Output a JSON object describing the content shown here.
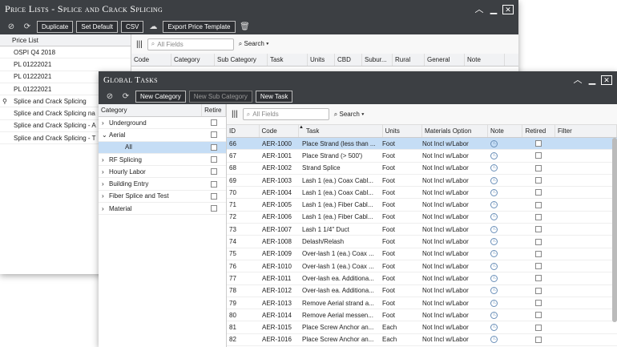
{
  "price_lists": {
    "title": "Price Lists - Splice and Crack Splicing",
    "buttons": {
      "duplicate": "Duplicate",
      "set_default": "Set Default",
      "csv": "CSV",
      "export": "Export Price Template"
    },
    "list_header": "Price List",
    "items": [
      "OSPI Q4 2018",
      "PL 01222021",
      "PL 01222021",
      "PL 01222021",
      "Splice and Crack Splicing",
      "Splice and Crack Splicing na",
      "Splice and Crack Splicing - A",
      "Splice and Crack Splicing - T"
    ],
    "search_placeholder": "All Fields",
    "search_label": "Search",
    "columns": [
      "Code",
      "Category",
      "Sub Category",
      "Task",
      "Units",
      "CBD",
      "Subur...",
      "Rural",
      "General",
      "Note"
    ]
  },
  "global_tasks": {
    "title": "Global Tasks",
    "buttons": {
      "new_category": "New Category",
      "new_sub_category": "New Sub Category",
      "new_task": "New Task"
    },
    "category_header": "Category",
    "retire_header": "Retire",
    "categories": [
      {
        "label": "Underground",
        "chev": "›",
        "indent": false,
        "sel": false
      },
      {
        "label": "Aerial",
        "chev": "⌄",
        "indent": false,
        "sel": false
      },
      {
        "label": "All",
        "chev": "",
        "indent": true,
        "sel": true
      },
      {
        "label": "RF Splicing",
        "chev": "›",
        "indent": false,
        "sel": false
      },
      {
        "label": "Hourly Labor",
        "chev": "›",
        "indent": false,
        "sel": false
      },
      {
        "label": "Building Entry",
        "chev": "›",
        "indent": false,
        "sel": false
      },
      {
        "label": "Fiber Splice and Test",
        "chev": "›",
        "indent": false,
        "sel": false
      },
      {
        "label": "Material",
        "chev": "›",
        "indent": false,
        "sel": false
      }
    ],
    "search_placeholder": "All Fields",
    "search_label": "Search",
    "columns": [
      "ID",
      "Code",
      "Task",
      "Units",
      "Materials Option",
      "Note",
      "Retired",
      "Filter"
    ],
    "rows": [
      [
        "66",
        "AER-1000",
        "Place Strand (less than ...",
        "Foot",
        "Not Incl w/Labor"
      ],
      [
        "67",
        "AER-1001",
        "Place Strand (> 500')",
        "Foot",
        "Not Incl w/Labor"
      ],
      [
        "68",
        "AER-1002",
        "Strand Splice",
        "Foot",
        "Not Incl w/Labor"
      ],
      [
        "69",
        "AER-1003",
        "Lash 1 (ea.) Coax Cabl...",
        "Foot",
        "Not Incl w/Labor"
      ],
      [
        "70",
        "AER-1004",
        "Lash 1 (ea.) Coax Cabl...",
        "Foot",
        "Not Incl w/Labor"
      ],
      [
        "71",
        "AER-1005",
        "Lash 1 (ea.) Fiber Cabl...",
        "Foot",
        "Not Incl w/Labor"
      ],
      [
        "72",
        "AER-1006",
        "Lash 1 (ea.) Fiber Cabl...",
        "Foot",
        "Not Incl w/Labor"
      ],
      [
        "73",
        "AER-1007",
        "Lash 1 1/4\" Duct",
        "Foot",
        "Not Incl w/Labor"
      ],
      [
        "74",
        "AER-1008",
        "Delash/Relash",
        "Foot",
        "Not Incl w/Labor"
      ],
      [
        "75",
        "AER-1009",
        "Over-lash 1 (ea.) Coax ...",
        "Foot",
        "Not Incl w/Labor"
      ],
      [
        "76",
        "AER-1010",
        "Over-lash 1 (ea.) Coax ...",
        "Foot",
        "Not Incl w/Labor"
      ],
      [
        "77",
        "AER-1011",
        "Over-lash ea. Additiona...",
        "Foot",
        "Not Incl w/Labor"
      ],
      [
        "78",
        "AER-1012",
        "Over-lash ea. Additiona...",
        "Foot",
        "Not Incl w/Labor"
      ],
      [
        "79",
        "AER-1013",
        "Remove Aerial strand a...",
        "Foot",
        "Not Incl w/Labor"
      ],
      [
        "80",
        "AER-1014",
        "Remove Aerial messen...",
        "Foot",
        "Not Incl w/Labor"
      ],
      [
        "81",
        "AER-1015",
        "Place Screw Anchor an...",
        "Each",
        "Not Incl w/Labor"
      ],
      [
        "82",
        "AER-1016",
        "Place Screw Anchor an...",
        "Each",
        "Not Incl w/Labor"
      ]
    ]
  }
}
